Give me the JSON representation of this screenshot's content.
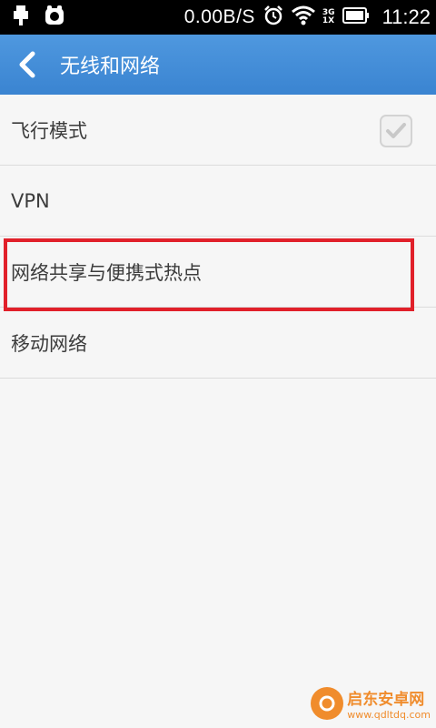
{
  "status_bar": {
    "speed": "0.00B/S",
    "network_top": "3G",
    "network_bottom": "1X",
    "time": "11:22",
    "icons": [
      "usb-icon",
      "app-notification-icon",
      "alarm-icon",
      "wifi-icon",
      "network-signal-icon",
      "battery-icon"
    ]
  },
  "header": {
    "title": "无线和网络",
    "back_icon": "chevron-left-icon",
    "color": "#4a93dc"
  },
  "settings": {
    "items": [
      {
        "label": "飞行模式",
        "checked": true
      },
      {
        "label": "VPN"
      },
      {
        "label": "网络共享与便携式热点",
        "highlighted": true
      },
      {
        "label": "移动网络"
      }
    ]
  },
  "highlight_color": "#e1202a",
  "watermark": {
    "main": "启东安卓网",
    "sub": "www.qdltdq.com"
  }
}
